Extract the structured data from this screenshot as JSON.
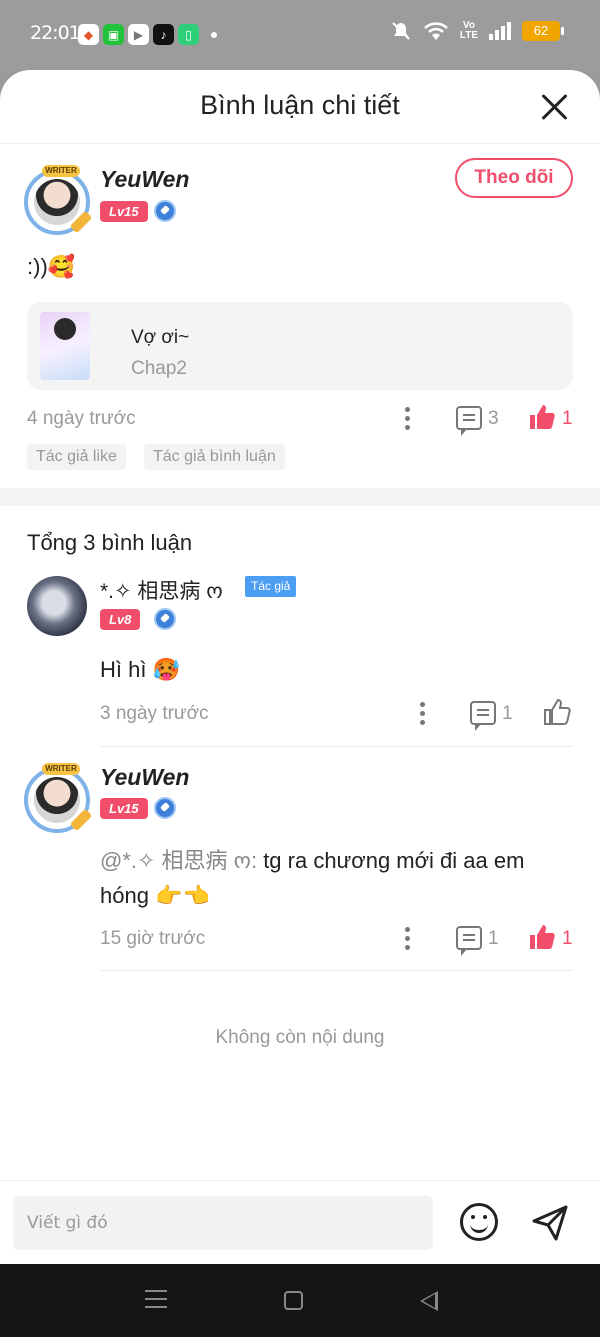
{
  "status_bar": {
    "time": "22:01",
    "apps": [
      "game-icon",
      "wechat-icon",
      "youtube-icon",
      "tiktok-icon",
      "app-icon"
    ],
    "volte": "Vo\nLTE",
    "battery": "62"
  },
  "header": {
    "title": "Bình luận chi tiết"
  },
  "main_comment": {
    "author": "YeuWen",
    "writer_tag": "WRITER",
    "level": "Lv15",
    "follow_label": "Theo dõi",
    "text": ":))🥰",
    "chapter": {
      "title": "Vợ ơi~",
      "subtitle": "Chap2"
    },
    "time": "4 ngày trước",
    "reply_count": "3",
    "like_count": "1",
    "tags": [
      "Tác giả like",
      "Tác giả bình luận"
    ]
  },
  "total_label": "Tổng 3 bình luận",
  "replies": [
    {
      "author": "*.✧ 相思病 ო",
      "author_tag": "Tác giả",
      "level": "Lv8",
      "text": "Hì hì 🥵",
      "time": "3 ngày trước",
      "reply_count": "1"
    },
    {
      "author": "YeuWen",
      "writer_tag": "WRITER",
      "level": "Lv15",
      "mention": "@*.✧ 相思病 ო: ",
      "text": "tg ra chương mới đi aa em hóng 👉👈",
      "time": "15 giờ trước",
      "reply_count": "1",
      "like_count": "1"
    }
  ],
  "end_text": "Không còn nội dung",
  "input": {
    "placeholder": "Viết gì đó"
  },
  "colors": {
    "accent": "#f04e6a",
    "author_tag": "#4c9ef2",
    "muted": "#999999"
  }
}
